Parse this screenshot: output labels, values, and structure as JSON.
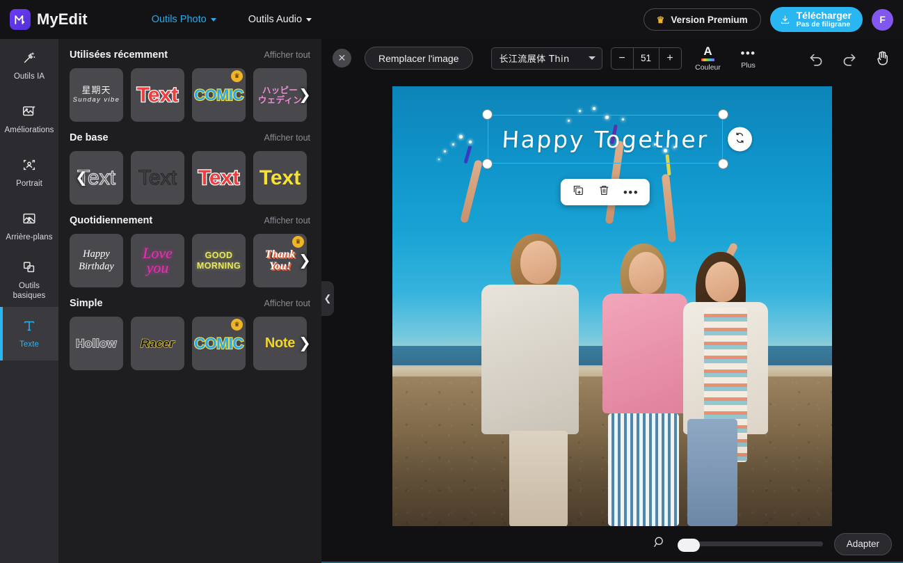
{
  "app": {
    "name": "MyEdit",
    "logo_icon": "myedit-logo-icon"
  },
  "topbar": {
    "nav": [
      {
        "label": "Outils Photo",
        "icon": "chevron-down-icon",
        "active": true
      },
      {
        "label": "Outils Audio",
        "icon": "chevron-down-icon",
        "active": false
      }
    ],
    "premium_label": "Version Premium",
    "premium_icon": "crown-icon",
    "download_title": "Télécharger",
    "download_subtitle": "Pas de filigrane",
    "download_icon": "download-icon",
    "avatar_initial": "F",
    "accent_blue": "#2ab6f0",
    "avatar_color": "#8257f0",
    "crown_color": "#f0b429"
  },
  "sidebar": {
    "items": [
      {
        "label": "Outils IA",
        "icon": "magic-wand-icon",
        "active": false
      },
      {
        "label": "Améliorations",
        "icon": "image-sparkle-icon",
        "active": false
      },
      {
        "label": "Portrait",
        "icon": "portrait-icon",
        "active": false
      },
      {
        "label": "Arrière-plans",
        "icon": "background-icon",
        "active": false
      },
      {
        "label": "Outils basiques",
        "icon": "layers-icon",
        "active": false
      },
      {
        "label": "Texte",
        "icon": "text-t-icon",
        "active": true
      }
    ],
    "active_color": "#2ab6f0"
  },
  "panel": {
    "show_all_label": "Afficher tout",
    "collapse_icon": "chevron-left-icon",
    "sections": [
      {
        "title": "Utilisées récemment",
        "has_next_arrow": true,
        "has_prev_arrow": false,
        "thumbs": [
          {
            "name": "sunday-vibe-template",
            "style": "sunday",
            "cn": "星期天",
            "en": "Sunday vibe",
            "premium": false
          },
          {
            "name": "text-red-template",
            "style": "text-red",
            "text": "Text",
            "premium": false
          },
          {
            "name": "comic-template",
            "style": "comic",
            "text": "COMIC",
            "premium": true
          },
          {
            "name": "happy-wedding-jp-template",
            "style": "jp",
            "line1": "ハッピー",
            "line2": "ウェディン",
            "premium": false
          }
        ]
      },
      {
        "title": "De base",
        "has_next_arrow": false,
        "has_prev_arrow": true,
        "thumbs": [
          {
            "name": "text-hollow-light-template",
            "style": "hollow-light",
            "text": "Text",
            "premium": false
          },
          {
            "name": "text-hollow-dark-template",
            "style": "hollow-dark",
            "text": "Text",
            "premium": false
          },
          {
            "name": "text-red-outline-template",
            "style": "text-red",
            "text": "Text",
            "premium": false
          },
          {
            "name": "text-yellow-template",
            "style": "text-yellow",
            "text": "Text",
            "premium": false
          }
        ]
      },
      {
        "title": "Quotidiennement",
        "has_next_arrow": true,
        "has_prev_arrow": false,
        "thumbs": [
          {
            "name": "happy-birthday-template",
            "style": "happy-bd",
            "line1": "Happy",
            "line2": "Birthday",
            "premium": false
          },
          {
            "name": "love-you-template",
            "style": "love",
            "line1": "Love",
            "line2": "you",
            "premium": false
          },
          {
            "name": "good-morning-template",
            "style": "goodm",
            "line1": "GOOD",
            "line2": "MORNING",
            "premium": false
          },
          {
            "name": "thank-you-template",
            "style": "thank",
            "line1": "Thank",
            "line2": "You!",
            "premium": true
          }
        ]
      },
      {
        "title": "Simple",
        "has_next_arrow": true,
        "has_prev_arrow": false,
        "thumbs": [
          {
            "name": "hollow-template",
            "style": "hollow2",
            "text": "Hollow",
            "premium": false
          },
          {
            "name": "racer-template",
            "style": "racer",
            "text": "Racer",
            "premium": false
          },
          {
            "name": "comic-simple-template",
            "style": "comic",
            "text": "COMIC",
            "premium": true
          },
          {
            "name": "note-template",
            "style": "note",
            "text": "Note",
            "premium": false
          }
        ]
      }
    ]
  },
  "toolbar": {
    "close_icon": "close-icon",
    "replace_image_label": "Remplacer l'image",
    "font_name": "长江流展体 Thin",
    "font_caret_icon": "chevron-down-icon",
    "font_size": "51",
    "decrease_icon": "minus-icon",
    "increase_icon": "plus-icon",
    "color_label": "Couleur",
    "color_icon": "letter-a-color-icon",
    "more_label": "Plus",
    "more_icon": "ellipsis-icon",
    "undo_icon": "undo-icon",
    "redo_icon": "redo-icon",
    "hand_icon": "hand-icon"
  },
  "canvas": {
    "text_object": {
      "content": "Happy Together",
      "color": "#ffffff",
      "selection_color": "#2ab6f0",
      "rotate_icon": "rotate-icon"
    },
    "float_actions": [
      {
        "name": "duplicate-button",
        "icon": "duplicate-icon"
      },
      {
        "name": "delete-button",
        "icon": "trash-icon"
      },
      {
        "name": "more-button",
        "icon": "ellipsis-icon"
      }
    ],
    "photo_description": "Trois femmes sur la plage au coucher du soleil avec des cierges magiques"
  },
  "zoombar": {
    "zoom_icon": "magnifier-icon",
    "slider_value": 0,
    "fit_label": "Adapter"
  }
}
